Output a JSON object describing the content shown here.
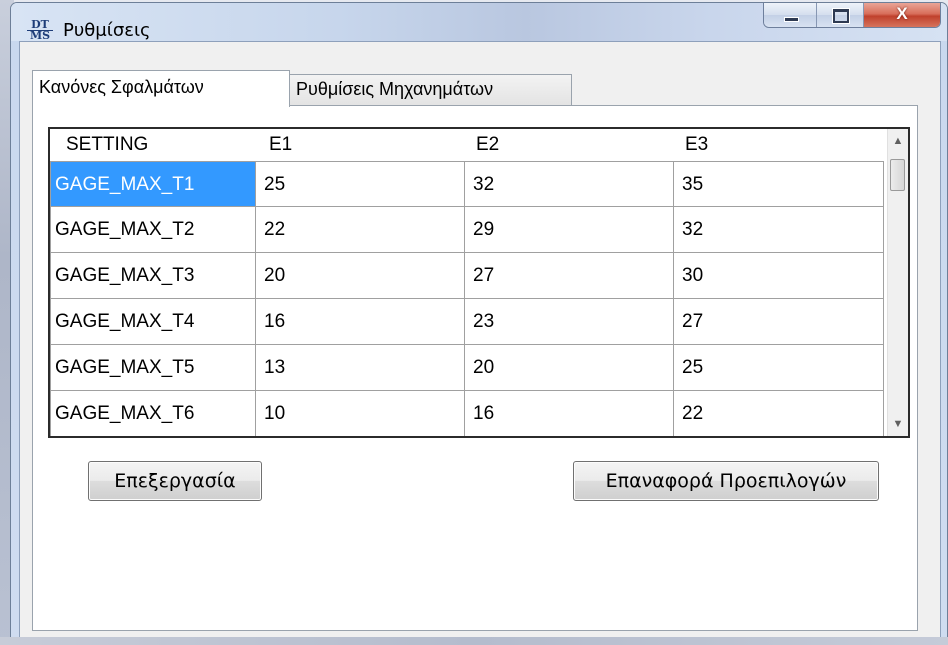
{
  "window": {
    "title": "Ρυθμίσεις",
    "logo_line1": "DT",
    "logo_line2": "MS",
    "close_glyph": "X"
  },
  "tabs": [
    {
      "label": "Κανόνες Σφαλμάτων",
      "active": true
    },
    {
      "label": "Ρυθμίσεις Μηχανημάτων",
      "active": false
    }
  ],
  "grid": {
    "columns": [
      "SETTING",
      "E1",
      "E2",
      "E3"
    ],
    "rows": [
      [
        "GAGE_MAX_T1",
        "25",
        "32",
        "35"
      ],
      [
        "GAGE_MAX_T2",
        "22",
        "29",
        "32"
      ],
      [
        "GAGE_MAX_T3",
        "20",
        "27",
        "30"
      ],
      [
        "GAGE_MAX_T4",
        "16",
        "23",
        "27"
      ],
      [
        "GAGE_MAX_T5",
        "13",
        "20",
        "25"
      ],
      [
        "GAGE_MAX_T6",
        "10",
        "16",
        "22"
      ]
    ],
    "selected_row": 0,
    "selected_col": 0
  },
  "buttons": {
    "edit_label": "Επεξεργασία",
    "reset_label": "Επαναφορά Προεπιλογών"
  },
  "icons": {
    "minimize": "minimize-icon",
    "maximize": "maximize-icon",
    "close": "close-icon",
    "scroll_up": "scroll-up-arrow-icon",
    "scroll_down": "scroll-down-arrow-icon"
  },
  "colors": {
    "selection": "#3399ff",
    "close_button": "#c0412c"
  }
}
